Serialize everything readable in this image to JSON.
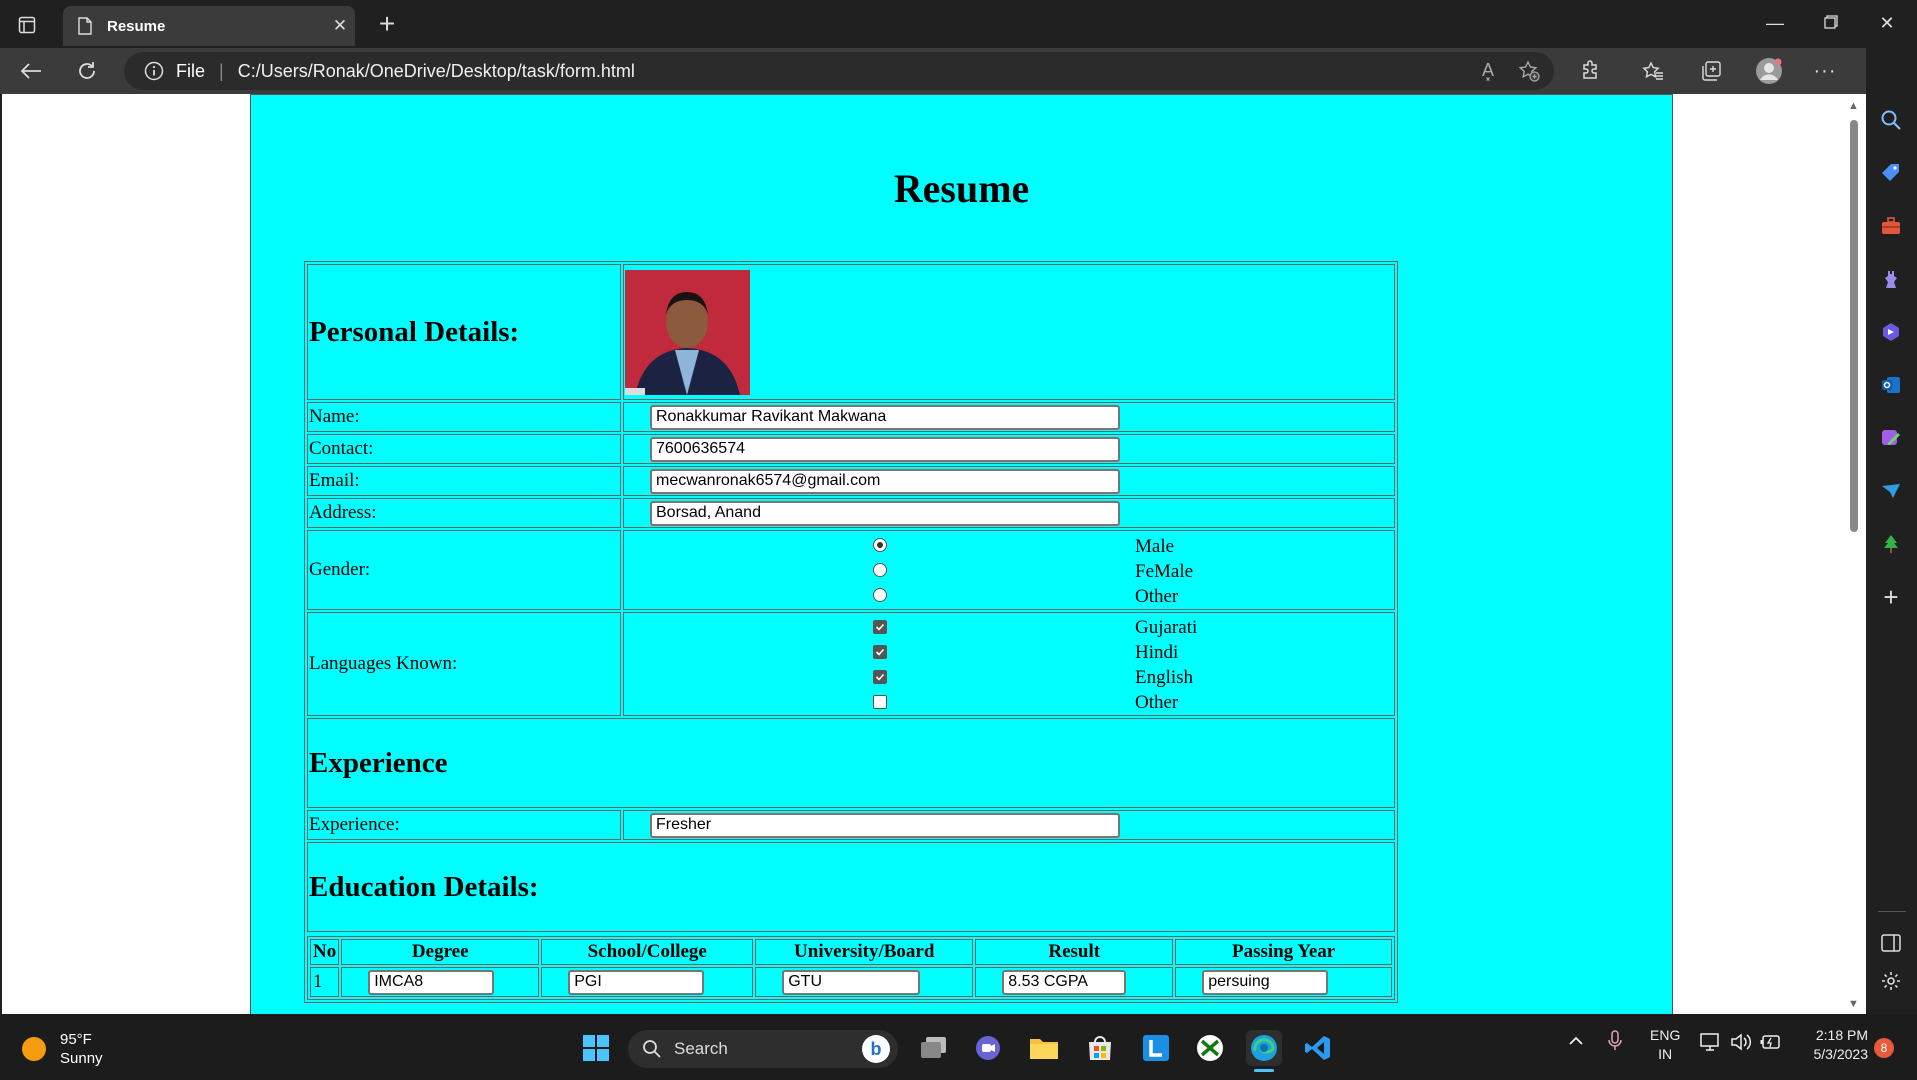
{
  "browser": {
    "tab_title": "Resume",
    "address_file_label": "File",
    "address_url": "C:/Users/Ronak/OneDrive/Desktop/task/form.html",
    "read_aloud_label": "A͓"
  },
  "page": {
    "title": "Resume",
    "personal_details_heading": "Personal Details:",
    "fields": {
      "name": {
        "label": "Name:",
        "value": "Ronakkumar Ravikant Makwana"
      },
      "contact": {
        "label": "Contact:",
        "value": "7600636574"
      },
      "email": {
        "label": "Email:",
        "value": "mecwanronak6574@gmail.com"
      },
      "address": {
        "label": "Address:",
        "value": "Borsad, Anand"
      }
    },
    "gender": {
      "label": "Gender:",
      "options": [
        {
          "label": "Male",
          "checked": true
        },
        {
          "label": "FeMale",
          "checked": false
        },
        {
          "label": "Other",
          "checked": false
        }
      ]
    },
    "languages": {
      "label": "Languages Known:",
      "options": [
        {
          "label": "Gujarati",
          "checked": true
        },
        {
          "label": "Hindi",
          "checked": true
        },
        {
          "label": "English",
          "checked": true
        },
        {
          "label": "Other",
          "checked": false
        }
      ]
    },
    "experience_heading": "Experience",
    "experience": {
      "label": "Experience:",
      "value": "Fresher"
    },
    "education_heading": "Education Details:",
    "education": {
      "columns": [
        "No",
        "Degree",
        "School/College",
        "University/Board",
        "Result",
        "Passing Year"
      ],
      "rows": [
        {
          "no": "1",
          "degree": "IMCA8",
          "school": "PGI",
          "university": "GTU",
          "result": "8.53 CGPA",
          "year": "persuing"
        }
      ]
    }
  },
  "taskbar": {
    "weather_temp": "95°F",
    "weather_desc": "Sunny",
    "search_label": "Search",
    "lang_top": "ENG",
    "lang_bottom": "IN",
    "time": "2:18 PM",
    "date": "5/3/2023",
    "notification_count": "8"
  },
  "colors": {
    "page_background": "#00ffff",
    "chrome_dark": "#202020",
    "toolbar": "#3b3b3b"
  }
}
